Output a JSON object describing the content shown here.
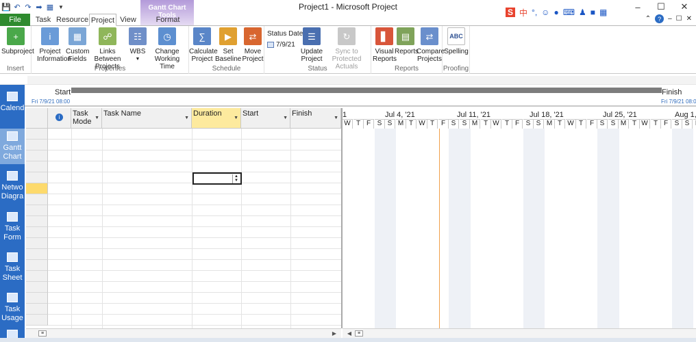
{
  "window": {
    "title": "Project1 - Microsoft Project",
    "context_tools": "Gantt Chart Tools"
  },
  "qat": {
    "icons": [
      "save-icon",
      "undo-icon",
      "redo-icon",
      "indent-icon",
      "gantt-icon",
      "dropdown-icon"
    ]
  },
  "tabs": [
    "File",
    "Task",
    "Resource",
    "Project",
    "View",
    "Format"
  ],
  "selected_tab": "Project",
  "ribbon": {
    "insert": {
      "label": "Insert",
      "subproject": "Subproject"
    },
    "properties": {
      "label": "Properties",
      "project_information": [
        "Project",
        "Information"
      ],
      "custom_fields": [
        "Custom",
        "Fields"
      ],
      "links_between_projects": [
        "Links Between",
        "Projects"
      ],
      "wbs": "WBS",
      "change_working_time": [
        "Change",
        "Working Time"
      ]
    },
    "schedule": {
      "label": "Schedule",
      "calculate_project": [
        "Calculate",
        "Project"
      ],
      "set_baseline": [
        "Set",
        "Baseline"
      ],
      "move_project": [
        "Move",
        "Project"
      ]
    },
    "status": {
      "label": "Status",
      "status_date_label": "Status Date:",
      "status_date_value": "7/9/21",
      "update_project": [
        "Update",
        "Project"
      ],
      "sync_to_protected_actuals": [
        "Sync to",
        "Protected Actuals"
      ]
    },
    "reports": {
      "label": "Reports",
      "visual_reports": [
        "Visual",
        "Reports"
      ],
      "reports": "Reports",
      "compare_projects": [
        "Compare",
        "Projects"
      ]
    },
    "proofing": {
      "label": "Proofing",
      "spelling": "Spelling"
    }
  },
  "timeline": {
    "start_label": "Start",
    "finish_label": "Finish",
    "start_date": "Fri 7/9/21 08:00",
    "finish_date": "Fri 7/9/21 08:00"
  },
  "view_bar": [
    "Calendar",
    "Gantt Chart",
    "Network Diagram",
    "Task Form",
    "Task Sheet",
    "Task Usage"
  ],
  "view_bar_visible": [
    [
      "Calend"
    ],
    [
      "Gantt",
      "Chart"
    ],
    [
      "Netwo",
      "Diagra"
    ],
    [
      "Task",
      "Form"
    ],
    [
      "Task",
      "Sheet"
    ],
    [
      "Task",
      "Usage"
    ]
  ],
  "columns": {
    "info": "i",
    "task_mode": [
      "Task",
      "Mode"
    ],
    "task_name": "Task Name",
    "duration": "Duration",
    "start": "Start",
    "finish": "Finish"
  },
  "timescale": {
    "weeks": [
      "1",
      "Jul 4, '21",
      "Jul 11, '21",
      "Jul 18, '21",
      "Jul 25, '21",
      "Aug 1,"
    ],
    "days": [
      "W",
      "T",
      "F",
      "S",
      "S",
      "M",
      "T",
      "W",
      "T",
      "F",
      "S",
      "S",
      "M",
      "T",
      "W",
      "T",
      "F",
      "S",
      "S",
      "M",
      "T",
      "W",
      "T",
      "F",
      "S",
      "S",
      "M",
      "T",
      "W",
      "T",
      "F",
      "S",
      "S",
      "M"
    ]
  },
  "colors": {
    "file_tab": "#2e8b2e",
    "view_bar": "#2b6cc4",
    "selection": "#fdea9e",
    "today_line": "#f0a14b"
  }
}
